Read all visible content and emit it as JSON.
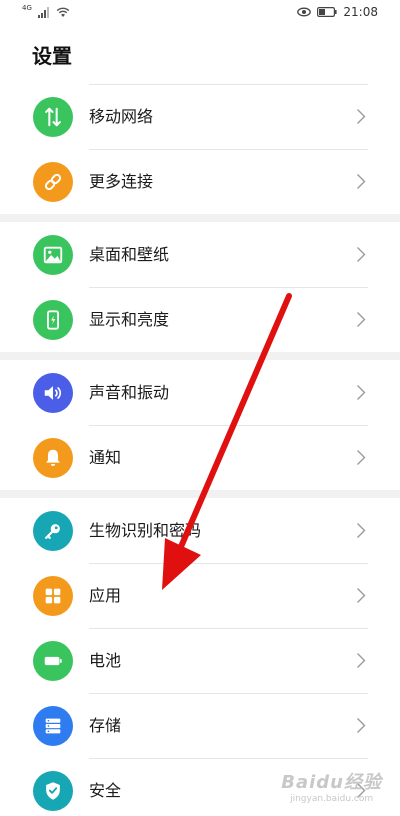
{
  "status_bar": {
    "network_type": "4G",
    "time": "21:08"
  },
  "page": {
    "title": "设置"
  },
  "settings": [
    {
      "label": "移动网络",
      "icon": "mobile-data-icon",
      "color": "#3ac45d"
    },
    {
      "label": "更多连接",
      "icon": "link-icon",
      "color": "#f39a1c"
    },
    {
      "label": "桌面和壁纸",
      "icon": "wallpaper-icon",
      "color": "#3ac45d"
    },
    {
      "label": "显示和亮度",
      "icon": "display-phone-icon",
      "color": "#3ac45d"
    },
    {
      "label": "声音和振动",
      "icon": "speaker-icon",
      "color": "#4a5ee8"
    },
    {
      "label": "通知",
      "icon": "bell-icon",
      "color": "#f39a1c"
    },
    {
      "label": "生物识别和密码",
      "icon": "key-icon",
      "color": "#17a6b4"
    },
    {
      "label": "应用",
      "icon": "apps-grid-icon",
      "color": "#f39a1c"
    },
    {
      "label": "电池",
      "icon": "battery-icon",
      "color": "#3ac45d"
    },
    {
      "label": "存储",
      "icon": "storage-icon",
      "color": "#2f7cf0"
    },
    {
      "label": "安全",
      "icon": "shield-check-icon",
      "color": "#17a6b4"
    }
  ],
  "annotation": {
    "arrow_color": "#e01010"
  },
  "watermark": {
    "main": "Baidu经验",
    "sub": "jingyan.baidu.com"
  }
}
